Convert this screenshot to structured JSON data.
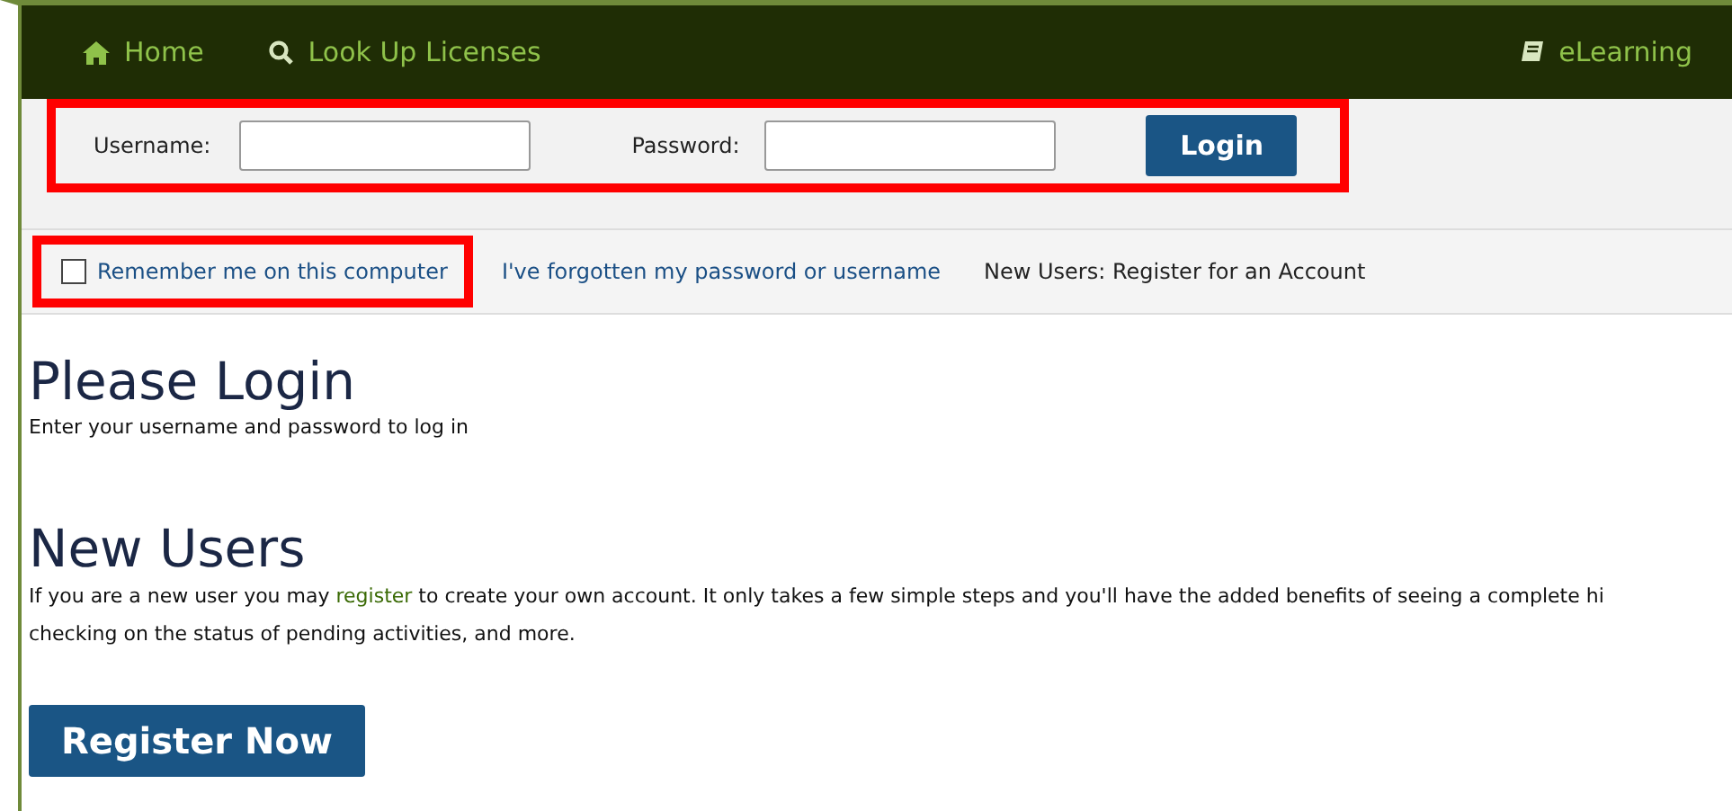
{
  "nav": {
    "left": [
      {
        "label": "Home",
        "kind": "home"
      },
      {
        "label": "Look Up Licenses",
        "kind": "search"
      }
    ],
    "right": {
      "label": "eLearning",
      "kind": "book"
    }
  },
  "login": {
    "username_label": "Username:",
    "password_label": "Password:",
    "button": "Login",
    "highlighted": true
  },
  "options": {
    "remember": {
      "label": "Remember me on this computer",
      "checked": false,
      "highlighted": true
    },
    "forgot": "I've forgotten my password or username",
    "register_account": "New Users: Register for an Account"
  },
  "please_login": {
    "heading": "Please Login",
    "text": "Enter your username and password to log in"
  },
  "new_users": {
    "heading": "New Users",
    "line_1_before": "If you are a new user you may ",
    "link": "register",
    "line_1_after": " to create your own account. It only takes a few simple steps and you'll have the added benefits of seeing a complete hi",
    "line_2": "checking on the status of pending activities, and more.",
    "button": "Register Now"
  }
}
